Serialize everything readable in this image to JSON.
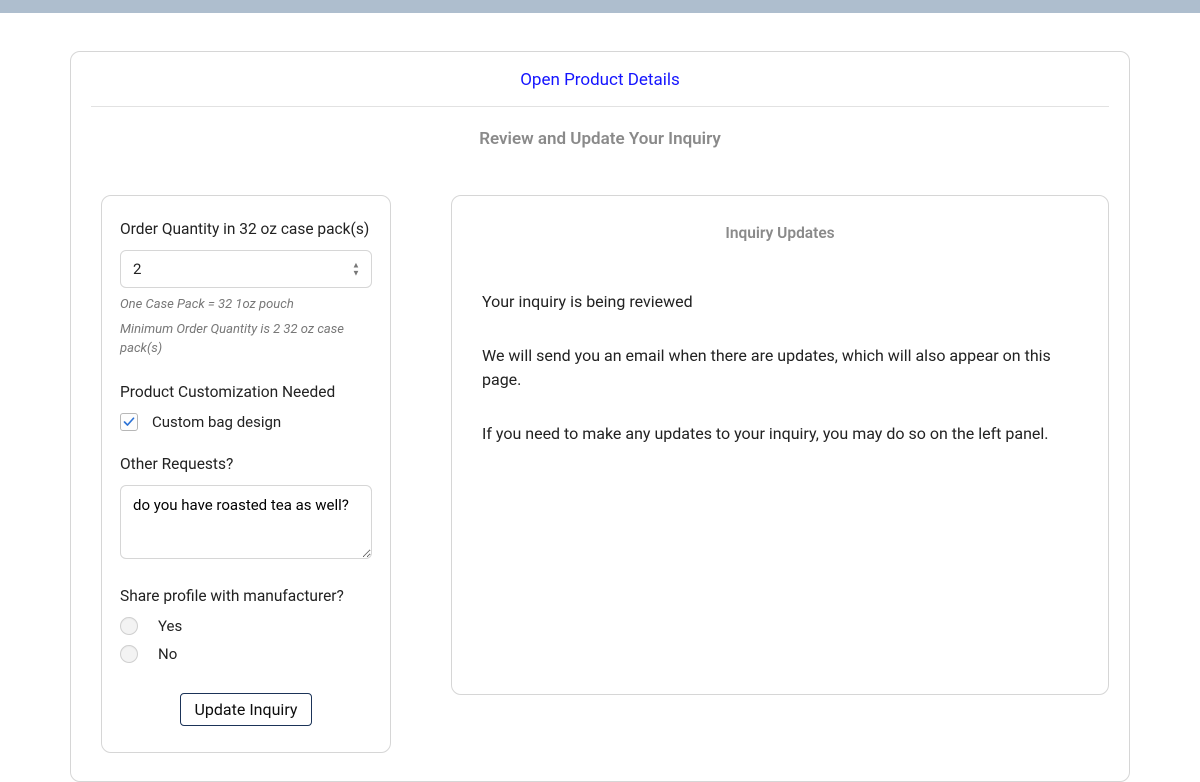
{
  "header": {
    "open_product_details": "Open Product Details",
    "review_title": "Review and Update Your Inquiry"
  },
  "form": {
    "quantity": {
      "label": "Order Quantity in 32 oz case pack(s)",
      "value": "2",
      "help1": "One Case Pack = 32 1oz pouch",
      "help2": "Minimum Order Quantity is 2 32 oz case pack(s)"
    },
    "customization": {
      "label": "Product Customization Needed",
      "option_label": "Custom bag design",
      "checked": true
    },
    "other_requests": {
      "label": "Other Requests?",
      "value": "do you have roasted tea as well?"
    },
    "share_profile": {
      "label": "Share profile with manufacturer?",
      "yes": "Yes",
      "no": "No"
    },
    "submit_label": "Update Inquiry"
  },
  "updates": {
    "title": "Inquiry Updates",
    "line1": "Your inquiry is being reviewed",
    "line2": "We will send you an email when there are updates, which will also appear on this page.",
    "line3": "If you need to make any updates to your inquiry, you may do so on the left panel."
  }
}
